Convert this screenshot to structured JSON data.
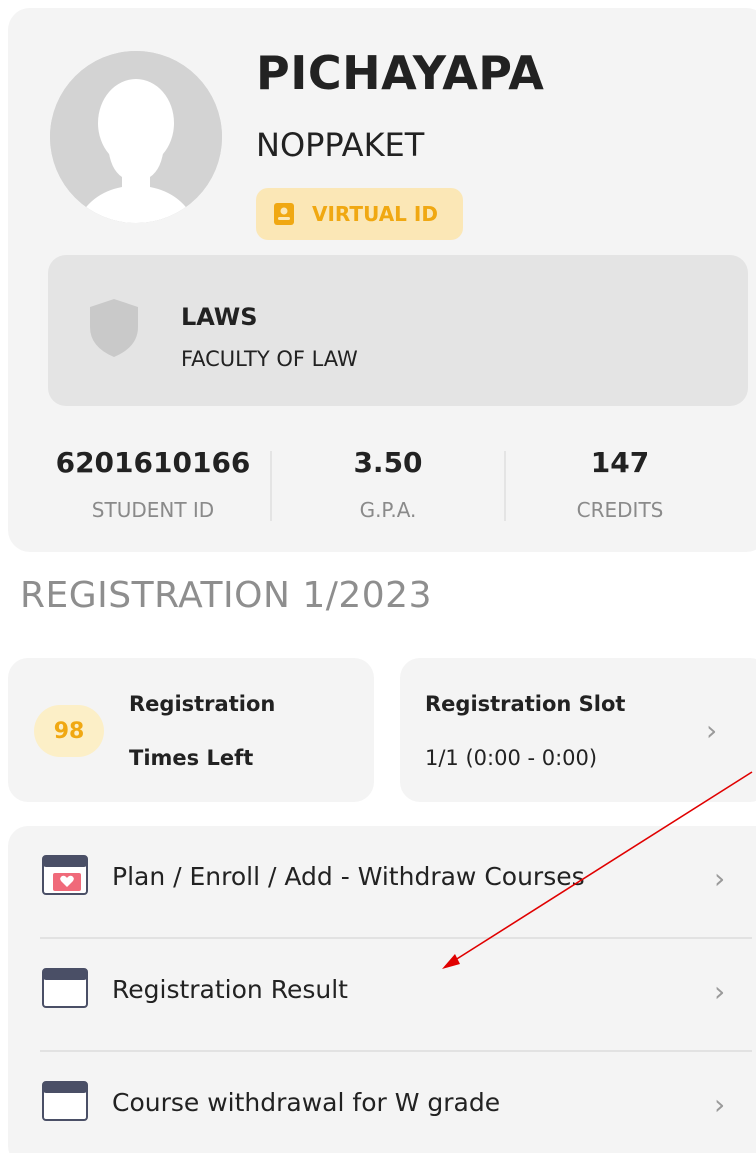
{
  "profile": {
    "first_name": "PICHAYAPA",
    "last_name": "NOPPAKET",
    "virtual_id_label": "VIRTUAL ID",
    "major": "LAWS",
    "faculty": "FACULTY OF LAW",
    "stats": [
      {
        "value": "6201610166",
        "label": "STUDENT ID"
      },
      {
        "value": "3.50",
        "label": "G.P.A."
      },
      {
        "value": "147",
        "label": "CREDITS"
      }
    ]
  },
  "registration": {
    "heading": "REGISTRATION 1/2023",
    "times_left": {
      "count": "98",
      "line1": "Registration",
      "line2": "Times Left"
    },
    "slot": {
      "title": "Registration Slot",
      "value": "1/1 (0:00 - 0:00)"
    }
  },
  "menu": {
    "items": [
      {
        "label": "Plan / Enroll / Add - Withdraw Courses",
        "icon": "calendar-heart-icon"
      },
      {
        "label": "Registration Result",
        "icon": "calendar-icon"
      },
      {
        "label": "Course withdrawal for W grade",
        "icon": "calendar-icon"
      }
    ]
  },
  "colors": {
    "accent_yellow": "#f0a812",
    "badge_bg": "#fbe7b6",
    "card_bg": "#f4f4f4",
    "annotation_arrow": "#e00000"
  },
  "icons": {
    "chevron": "chevron-right-icon"
  }
}
